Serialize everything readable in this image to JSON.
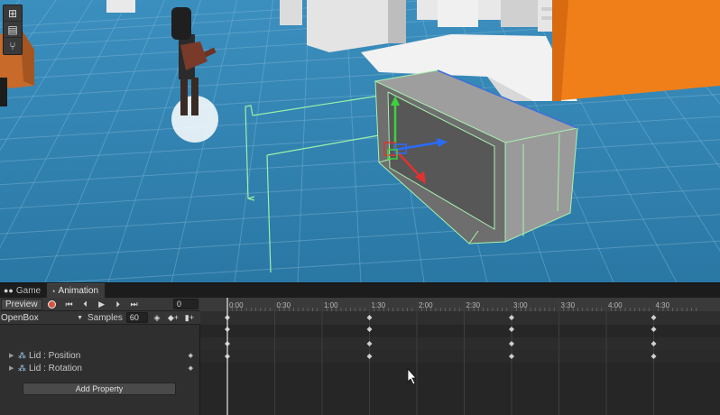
{
  "scene": {
    "tools": [
      {
        "icon": "grid-icon",
        "glyph": "⊞"
      },
      {
        "icon": "layers-icon",
        "glyph": "▤"
      },
      {
        "icon": "hierarchy-icon",
        "glyph": "⑂"
      }
    ]
  },
  "tabs": [
    {
      "label": "Game",
      "icon": "gamepad-icon",
      "glyph": "●●",
      "active": false
    },
    {
      "label": "Animation",
      "icon": "animation-icon",
      "glyph": "◔",
      "active": true
    }
  ],
  "controls": {
    "preview_label": "Preview",
    "record_icon": "record-icon",
    "first_key_glyph": "⏮",
    "prev_key_glyph": "⏴",
    "play_glyph": "▶",
    "next_key_glyph": "⏵",
    "last_key_glyph": "⏭",
    "current_frame": "0"
  },
  "clip": {
    "name": "OpenBox",
    "caret": "▼",
    "samples_label": "Samples",
    "samples_value": "60",
    "keyframe_glyph": "◈",
    "add_key_glyph": "◆+",
    "add_event_glyph": "▮+"
  },
  "properties": [
    {
      "arrow": "▶",
      "icon": "transform-icon",
      "glyph": "⁂",
      "label": "Lid : Position",
      "key_glyph": "◆"
    },
    {
      "arrow": "▶",
      "icon": "transform-icon",
      "glyph": "⁂",
      "label": "Lid : Rotation",
      "key_glyph": "◆"
    }
  ],
  "add_property_label": "Add Property",
  "timeline": {
    "ticks": [
      "0:00",
      "0:30",
      "1:00",
      "1:30",
      "2:00",
      "2:30",
      "3:00",
      "3:30",
      "4:00",
      "4:30"
    ],
    "keyframe_times": [
      "0:00",
      "1:30",
      "3:00",
      "4:30"
    ]
  },
  "colors": {
    "scene_background": "#2f80ab",
    "record_red": "#d9533a",
    "selection_green": "#9cf2a8",
    "axis_red": "#e03232",
    "axis_green": "#3cd23c",
    "axis_blue": "#2a6bff",
    "wall_orange": "#f07f1a"
  }
}
